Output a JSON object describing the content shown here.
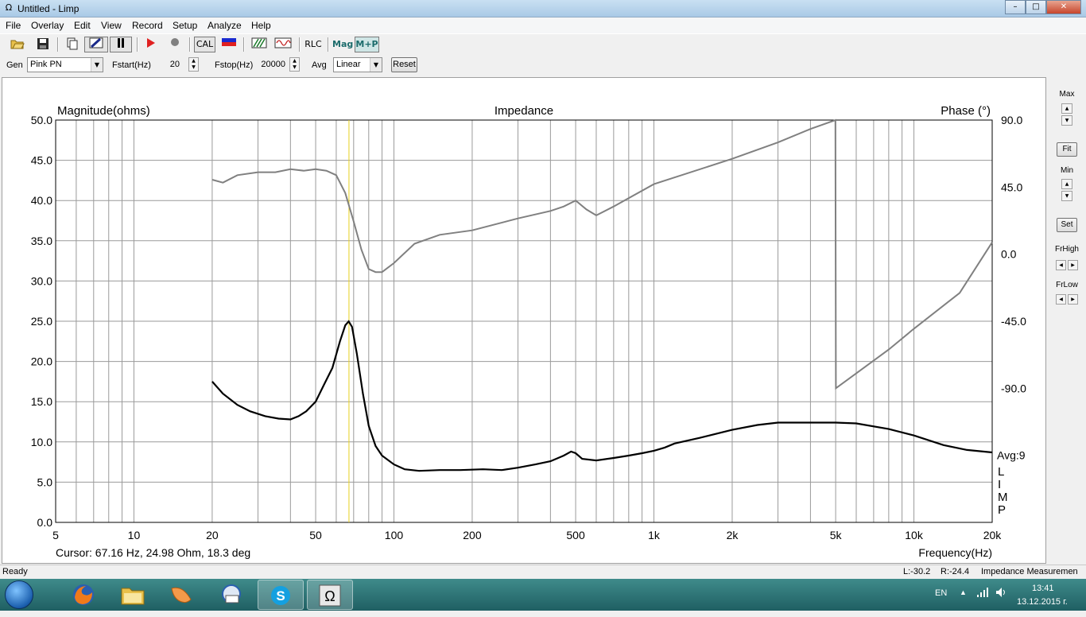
{
  "window": {
    "title": "Untitled - Limp",
    "icon": "omega-icon",
    "minimize": "–",
    "maximize": "□",
    "close": "✕"
  },
  "menu": [
    "File",
    "Overlay",
    "Edit",
    "View",
    "Record",
    "Setup",
    "Analyze",
    "Help"
  ],
  "toolbar": {
    "cal_label": "CAL",
    "rlc_label": "RLC",
    "mag_label": "Mag",
    "mp_label": "M+P"
  },
  "genbar": {
    "gen_label": "Gen",
    "gen_value": "Pink PN",
    "fstart_label": "Fstart(Hz)",
    "fstart_value": "20",
    "fstop_label": "Fstop(Hz)",
    "fstop_value": "20000",
    "avg_label": "Avg",
    "avg_value": "Linear",
    "reset_label": "Reset"
  },
  "side": {
    "max_label": "Max",
    "fit_label": "Fit",
    "min_label": "Min",
    "set_label": "Set",
    "frhigh_label": "FrHigh",
    "frlow_label": "FrLow"
  },
  "chart_data": {
    "type": "line",
    "title": "Impedance",
    "ylabel": "Magnitude(ohms)",
    "y2label": "Phase (°)",
    "xlabel": "Frequency(Hz)",
    "xscale": "log",
    "xlim": [
      5,
      20000
    ],
    "ylim": [
      0,
      50
    ],
    "y2lim": [
      -180,
      90
    ],
    "x_ticks": [
      "5",
      "10",
      "20",
      "50",
      "100",
      "200",
      "500",
      "1k",
      "2k",
      "5k",
      "10k",
      "20k"
    ],
    "x_tick_values": [
      5,
      10,
      20,
      50,
      100,
      200,
      500,
      1000,
      2000,
      5000,
      10000,
      20000
    ],
    "y_ticks": [
      "0.0",
      "5.0",
      "10.0",
      "15.0",
      "20.0",
      "25.0",
      "30.0",
      "35.0",
      "40.0",
      "45.0",
      "50.0"
    ],
    "y2_ticks": [
      "90.0",
      "45.0",
      "0.0",
      "-45.0",
      "-90.0"
    ],
    "y2_tick_values": [
      90,
      45,
      0,
      -45,
      -90
    ],
    "avg_text": "Avg:9",
    "side_letters": [
      "L",
      "I",
      "M",
      "P"
    ],
    "cursor_x": 67.16,
    "series": [
      {
        "kind": "magnitude",
        "color": "#000000",
        "x": [
          20,
          22,
          25,
          28,
          32,
          36,
          40,
          43,
          46,
          50,
          54,
          58,
          62,
          65,
          67,
          69,
          72,
          76,
          80,
          85,
          90,
          100,
          110,
          125,
          150,
          180,
          220,
          260,
          300,
          350,
          400,
          450,
          480,
          500,
          530,
          600,
          700,
          800,
          900,
          1000,
          1100,
          1200,
          1500,
          2000,
          2500,
          3000,
          4000,
          5000,
          6000,
          8000,
          10000,
          13000,
          16000,
          20000
        ],
        "y": [
          17.5,
          16.0,
          14.6,
          13.8,
          13.2,
          12.9,
          12.8,
          13.2,
          13.8,
          15.0,
          17.2,
          19.2,
          22.5,
          24.5,
          24.98,
          24.3,
          21.0,
          16.0,
          12.0,
          9.5,
          8.3,
          7.2,
          6.6,
          6.4,
          6.5,
          6.5,
          6.6,
          6.5,
          6.8,
          7.2,
          7.6,
          8.3,
          8.8,
          8.6,
          7.9,
          7.7,
          8.0,
          8.3,
          8.6,
          8.9,
          9.3,
          9.8,
          10.5,
          11.5,
          12.1,
          12.4,
          12.4,
          12.4,
          12.3,
          11.6,
          10.8,
          9.6,
          9.0,
          8.7
        ]
      },
      {
        "kind": "phase",
        "color": "#808080",
        "x": [
          20,
          22,
          25,
          30,
          35,
          40,
          45,
          50,
          55,
          60,
          65,
          70,
          75,
          80,
          85,
          90,
          100,
          120,
          150,
          200,
          300,
          400,
          450,
          500,
          550,
          600,
          700,
          1000,
          2000,
          3000,
          4000,
          4990,
          5010,
          6000,
          8000,
          10000,
          15000,
          20000
        ],
        "y": [
          50,
          48,
          53,
          55,
          55,
          57,
          56,
          57,
          56,
          53,
          41,
          22,
          3,
          -10,
          -12,
          -12,
          -6,
          7,
          13,
          16,
          24,
          29,
          32,
          36,
          30,
          26,
          32,
          47,
          64,
          75,
          84,
          90,
          -90,
          -80,
          -64,
          -50,
          -26,
          8
        ]
      }
    ]
  },
  "cursor_text": "Cursor: 67.16 Hz, 24.98 Ohm, 18.3 deg",
  "status": {
    "left": "Ready",
    "l_value": "L:-30.2",
    "r_value": "R:-24.4",
    "mode": "Impedance Measuremen"
  },
  "taskbar": {
    "items": [
      "firefox-icon",
      "folder-icon",
      "fruit-icon",
      "mail-icon",
      "skype-icon",
      "limp-icon"
    ],
    "lang": "EN",
    "time": "13:41",
    "date": "13.12.2015 г."
  }
}
